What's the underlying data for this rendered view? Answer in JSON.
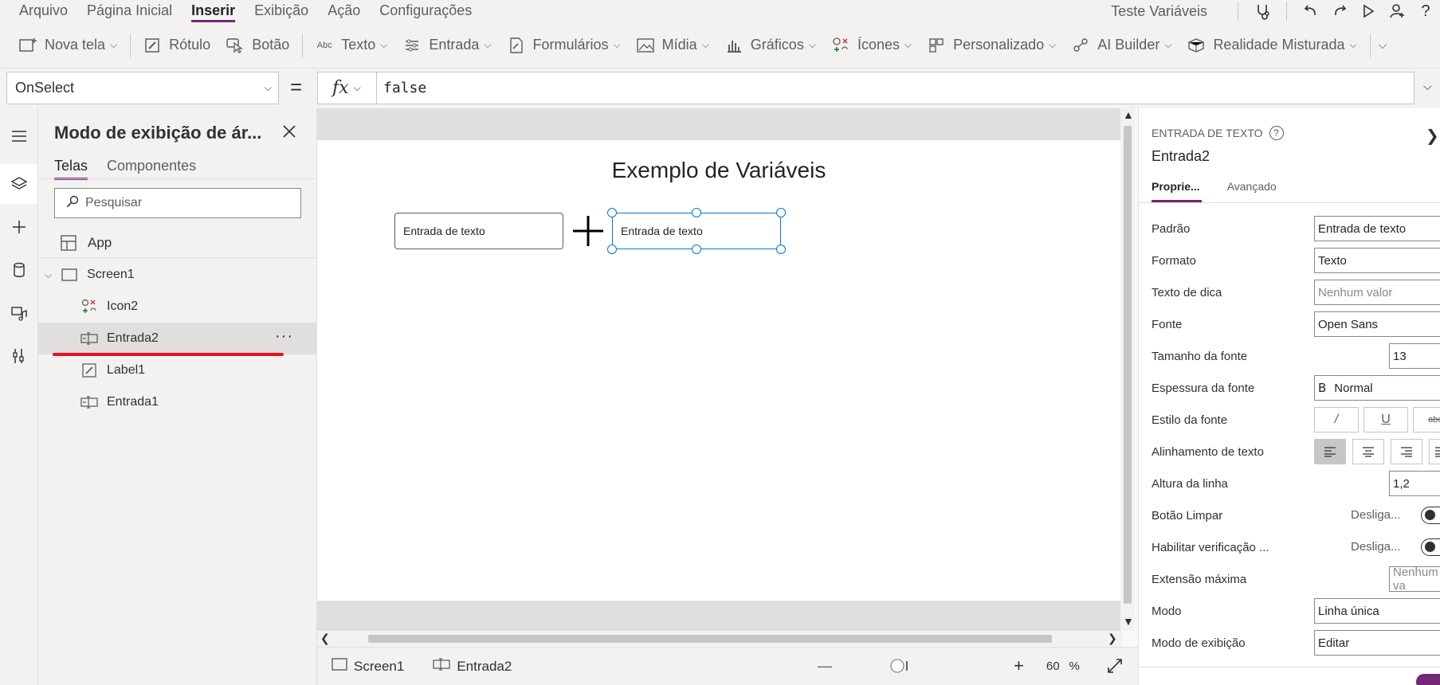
{
  "menubar": {
    "items": [
      "Arquivo",
      "Página Inicial",
      "Inserir",
      "Exibição",
      "Ação",
      "Configurações"
    ],
    "active": "Inserir",
    "app_name": "Teste Variáveis"
  },
  "ribbon": {
    "nova_tela": "Nova tela",
    "rotulo": "Rótulo",
    "botao": "Botão",
    "texto": "Texto",
    "entrada": "Entrada",
    "formularios": "Formulários",
    "midia": "Mídia",
    "graficos": "Gráficos",
    "icones": "Ícones",
    "personalizado": "Personalizado",
    "ai_builder": "AI Builder",
    "realidade": "Realidade Misturada"
  },
  "formula_bar": {
    "property": "OnSelect",
    "equals": "=",
    "fx": "fx",
    "formula": "false"
  },
  "tree": {
    "title": "Modo de exibição de ár...",
    "tabs": [
      "Telas",
      "Componentes"
    ],
    "search_placeholder": "Pesquisar",
    "app_label": "App",
    "screen": "Screen1",
    "children": [
      "Icon2",
      "Entrada2",
      "Label1",
      "Entrada1"
    ],
    "more": "···"
  },
  "canvas": {
    "title": "Exemplo de Variáveis",
    "input1": "Entrada de texto",
    "input2": "Entrada de texto"
  },
  "statusbar": {
    "screen": "Screen1",
    "control": "Entrada2",
    "zoom_minus": "—",
    "zoom_plus": "+",
    "zoom": "60",
    "percent": "%"
  },
  "props": {
    "type": "ENTRADA DE TEXTO",
    "name": "Entrada2",
    "tabs": [
      "Proprie...",
      "Avançado"
    ],
    "rows": {
      "padrao": {
        "label": "Padrão",
        "value": "Entrada de texto"
      },
      "formato": {
        "label": "Formato",
        "value": "Texto"
      },
      "dica": {
        "label": "Texto de dica",
        "value": "Nenhum valor"
      },
      "fonte": {
        "label": "Fonte",
        "value": "Open Sans"
      },
      "tamanho": {
        "label": "Tamanho da fonte",
        "value": "13"
      },
      "espessura": {
        "label": "Espessura da fonte",
        "value": "Normal"
      },
      "estilo": {
        "label": "Estilo da fonte"
      },
      "alinhamento": {
        "label": "Alinhamento de texto"
      },
      "altura": {
        "label": "Altura da linha",
        "value": "1,2"
      },
      "limpar": {
        "label": "Botão Limpar",
        "value": "Desliga..."
      },
      "verificacao": {
        "label": "Habilitar verificação ...",
        "value": "Desliga..."
      },
      "extensao": {
        "label": "Extensão máxima",
        "value": "Nenhum va"
      },
      "modo": {
        "label": "Modo",
        "value": "Linha única"
      },
      "exibicao": {
        "label": "Modo de exibição",
        "value": "Editar"
      }
    }
  },
  "colors": {
    "accent": "#742774",
    "selection": "#0078d4",
    "highlight": "#e81123"
  }
}
